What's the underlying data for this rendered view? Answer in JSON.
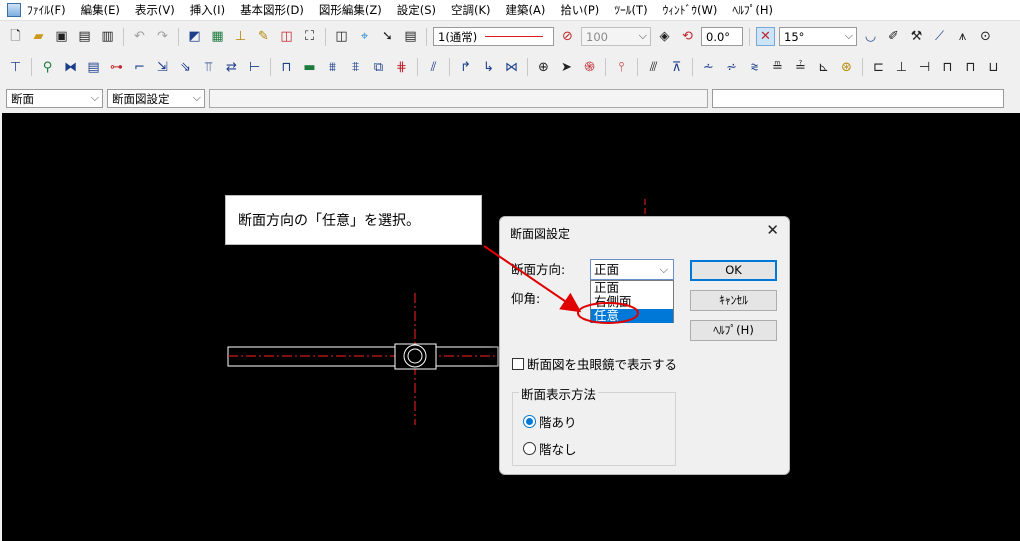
{
  "menu": {
    "items": [
      "ﾌｧｲﾙ(F)",
      "編集(E)",
      "表示(V)",
      "挿入(I)",
      "基本図形(D)",
      "図形編集(Z)",
      "設定(S)",
      "空調(K)",
      "建築(A)",
      "拾い(P)",
      "ﾂｰﾙ(T)",
      "ｳｨﾝﾄﾞｳ(W)",
      "ﾍﾙﾌﾟ(H)"
    ]
  },
  "toolbar1": {
    "layer_value": "1(通常)",
    "scale_value": "100",
    "angle_value": "0.0°",
    "snap_angle_value": "15°",
    "line_color": "#e02020"
  },
  "toolbar3": {
    "view_select": "断面",
    "setting_select": "断面図設定"
  },
  "callout": {
    "text": "断面方向の「任意」を選択。"
  },
  "dialog": {
    "title": "断面図設定",
    "direction_label": "断面方向:",
    "direction_value": "正面",
    "direction_options": [
      "正面",
      "右側面",
      "任意"
    ],
    "elevation_label": "仰角:",
    "ok_label": "OK",
    "cancel_label": "ｷｬﾝｾﾙ",
    "help_label": "ﾍﾙﾌﾟ(H)",
    "loupe_checkbox_label": "断面図を虫眼鏡で表示する",
    "loupe_checked": false,
    "method_group_label": "断面表示方法",
    "method_options": [
      "階あり",
      "階なし"
    ],
    "method_selected": "階あり"
  },
  "colors": {
    "canvas_background": "#000000",
    "centerline": "#ff2020",
    "annotation": "#e00000",
    "selection": "#0078d7"
  }
}
